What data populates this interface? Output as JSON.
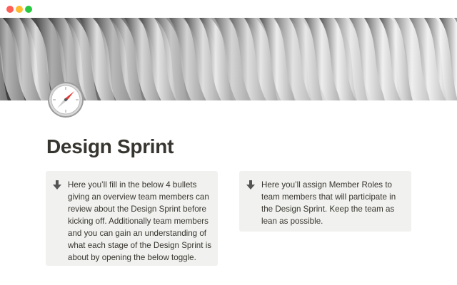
{
  "window": {
    "controls": [
      "close",
      "minimize",
      "zoom"
    ],
    "colors": {
      "close": "#fe5f57",
      "minimize": "#febc2e",
      "zoom": "#28c840"
    }
  },
  "cover": {
    "icon": "architecture-photo"
  },
  "page": {
    "icon": "compass-icon",
    "title": "Design Sprint"
  },
  "callouts": [
    {
      "icon": "arrow-down-icon",
      "text": "Here you’ll fill in the below 4 bullets giving an overview team members can review about the Design Sprint before kicking off. Additionally team members and you can gain an understanding of what each stage of the Design Sprint is about by opening the below toggle."
    },
    {
      "icon": "arrow-down-icon",
      "text": "Here you’ll assign Member Roles to team members that will participate in the Design Sprint. Keep the team as lean as possible."
    }
  ],
  "colors": {
    "text": "#37352f",
    "callout_bg": "#f1f1ef"
  }
}
